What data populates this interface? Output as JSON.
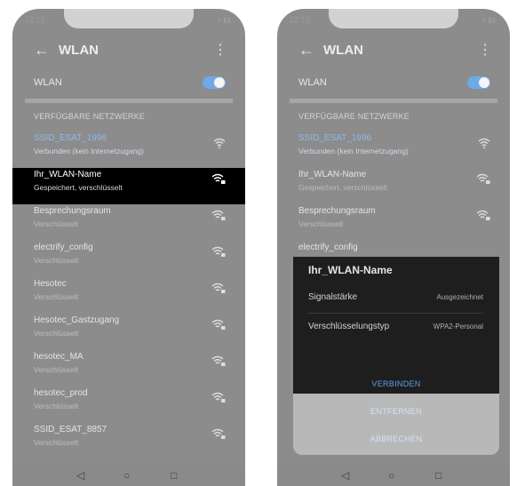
{
  "status_bar": {
    "time": "12:13",
    "icons": "▾ ▮▮"
  },
  "app_bar": {
    "title": "WLAN",
    "back_icon": "←",
    "menu_icon": "⋮"
  },
  "wlan_toggle": {
    "label": "WLAN",
    "enabled": true,
    "accent": "#6fa9e8"
  },
  "section_header": "VERFÜGBARE NETZWERKE",
  "left_networks": [
    {
      "name": "SSID_ESAT_1996",
      "status": "Verbunden (kein Internetzugang)"
    },
    {
      "name": "Ihr_WLAN-Name",
      "status": "Gespeichert, verschlüsselt"
    },
    {
      "name": "Besprechungsraum",
      "status": "Verschlüsselt"
    },
    {
      "name": "electrify_config",
      "status": "Verschlüsselt"
    },
    {
      "name": "Hesotec",
      "status": "Verschlüsselt"
    },
    {
      "name": "Hesotec_Gastzugang",
      "status": "Verschlüsselt"
    },
    {
      "name": "hesotec_MA",
      "status": "Verschlüsselt"
    },
    {
      "name": "hesotec_prod",
      "status": "Verschlüsselt"
    },
    {
      "name": "SSID_ESAT_8857",
      "status": "Verschlüsselt"
    }
  ],
  "right_networks": [
    {
      "name": "SSID_ESAT_1996",
      "status": "Verbunden (kein Internetzugang)"
    },
    {
      "name": "Ihr_WLAN-Name",
      "status": "Gespeichert, verschlüsselt"
    },
    {
      "name": "Besprechungsraum",
      "status": "Verschlüsselt"
    },
    {
      "name": "electrify_config",
      "status": ""
    }
  ],
  "dialog": {
    "title": "Ihr_WLAN-Name",
    "signal_label": "Signalstärke",
    "signal_value": "Ausgezeichnet",
    "encryption_label": "Verschlüsselungstyp",
    "encryption_value": "WPA2-Personal",
    "connect_label": "VERBINDEN",
    "remove_label": "ENTFERNEN",
    "cancel_label": "ABBRECHEN"
  },
  "nav": {
    "back": "◁",
    "home": "○",
    "recents": "□"
  }
}
